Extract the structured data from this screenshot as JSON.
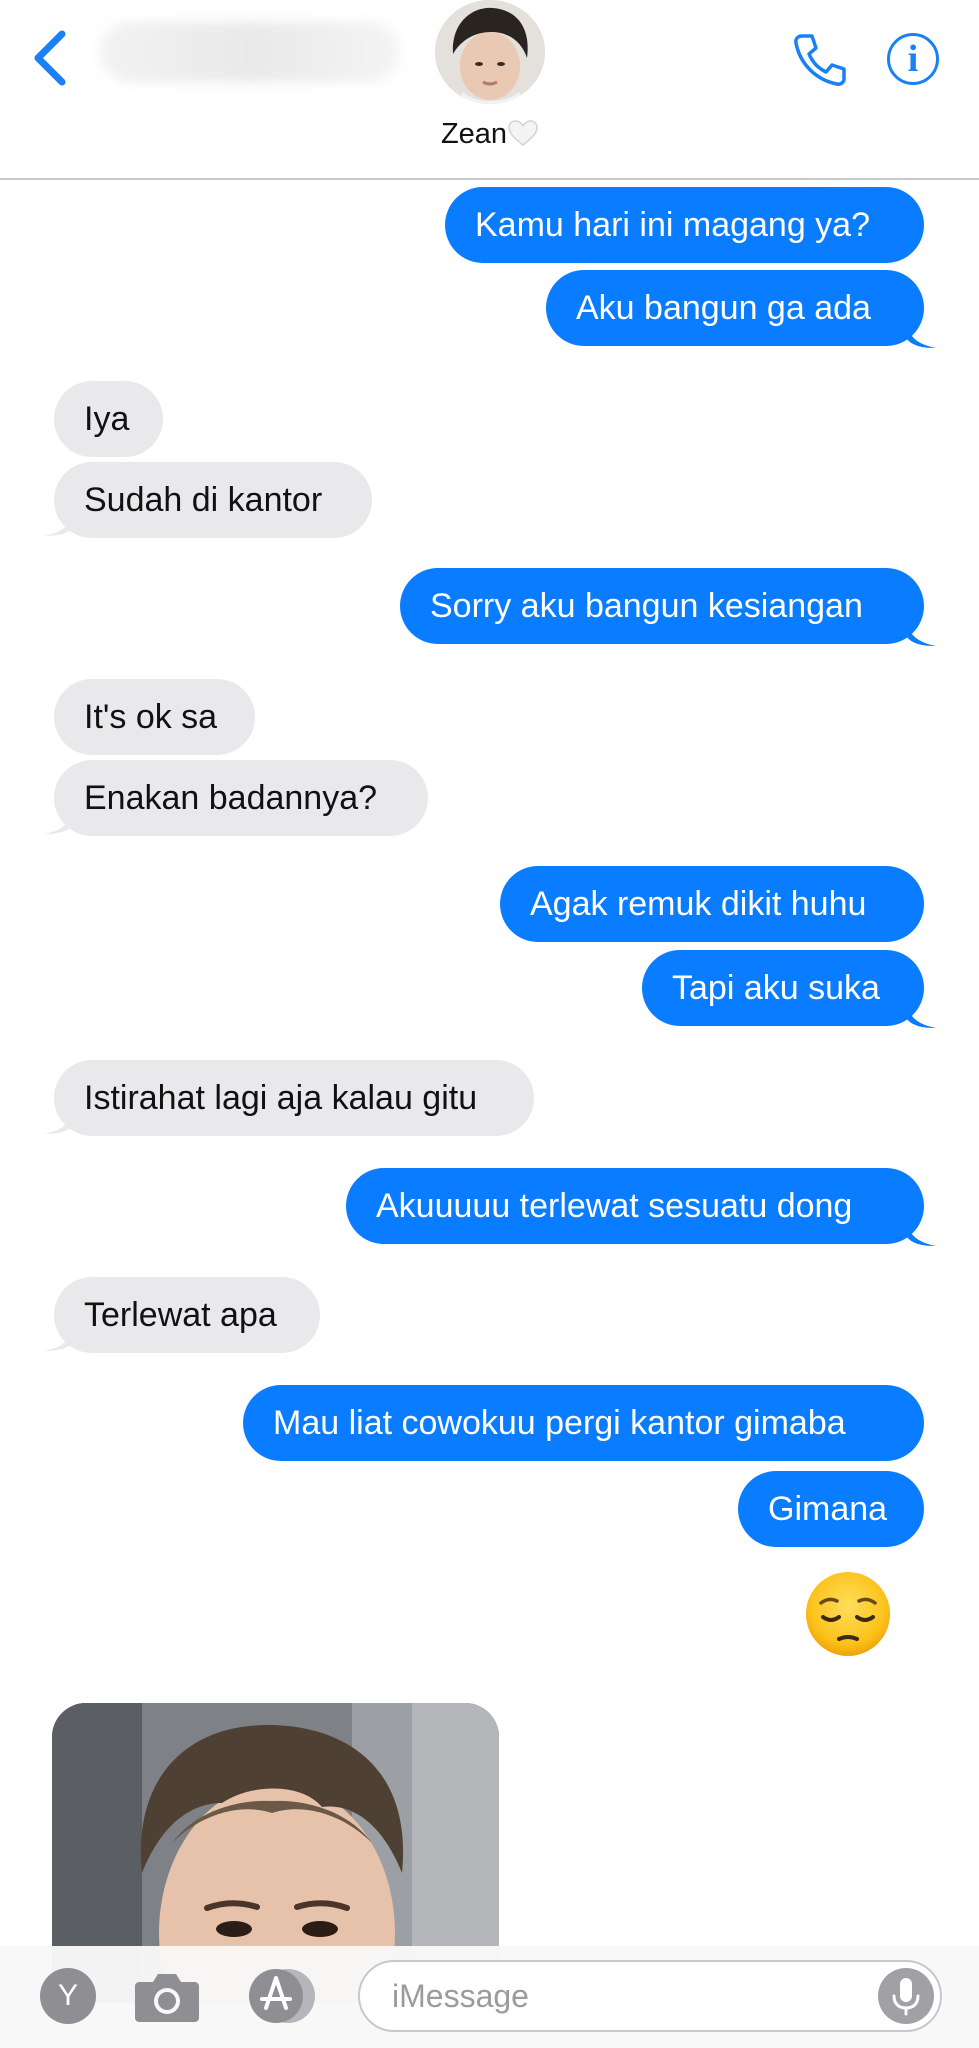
{
  "header": {
    "contact_name": "Zean",
    "back_icon": "chevron-left-icon",
    "phone_icon": "phone-icon",
    "info_icon": "info-icon",
    "info_glyph": "i",
    "accent_color": "#1a80f5"
  },
  "messages": [
    {
      "from": "me",
      "text": "Kamu hari ini magang ya?"
    },
    {
      "from": "me",
      "text": "Aku bangun ga ada"
    },
    {
      "from": "them",
      "text": "Iya"
    },
    {
      "from": "them",
      "text": "Sudah di kantor"
    },
    {
      "from": "me",
      "text": "Sorry aku bangun kesiangan"
    },
    {
      "from": "them",
      "text": "It's ok sa"
    },
    {
      "from": "them",
      "text": "Enakan badannya?"
    },
    {
      "from": "me",
      "text": "Agak remuk dikit huhu"
    },
    {
      "from": "me",
      "text": "Tapi aku suka"
    },
    {
      "from": "them",
      "text": "Istirahat lagi aja kalau gitu"
    },
    {
      "from": "me",
      "text": "Akuuuuu terlewat sesuatu dong"
    },
    {
      "from": "them",
      "text": "Terlewat apa"
    },
    {
      "from": "me",
      "text": "Mau liat cowokuu pergi kantor gimaba"
    },
    {
      "from": "me",
      "text": "Gimana"
    },
    {
      "from": "me",
      "emoji": "pensive-face-emoji"
    },
    {
      "from": "them",
      "attachment": "photo"
    }
  ],
  "colors": {
    "sent_bubble": "#0a7cff",
    "received_bubble": "#e9e9eb"
  },
  "input_bar": {
    "y_button_label": "Y",
    "camera_icon": "camera-icon",
    "app_store_icon": "app-store-icon",
    "placeholder": "iMessage",
    "mic_icon": "microphone-icon"
  }
}
